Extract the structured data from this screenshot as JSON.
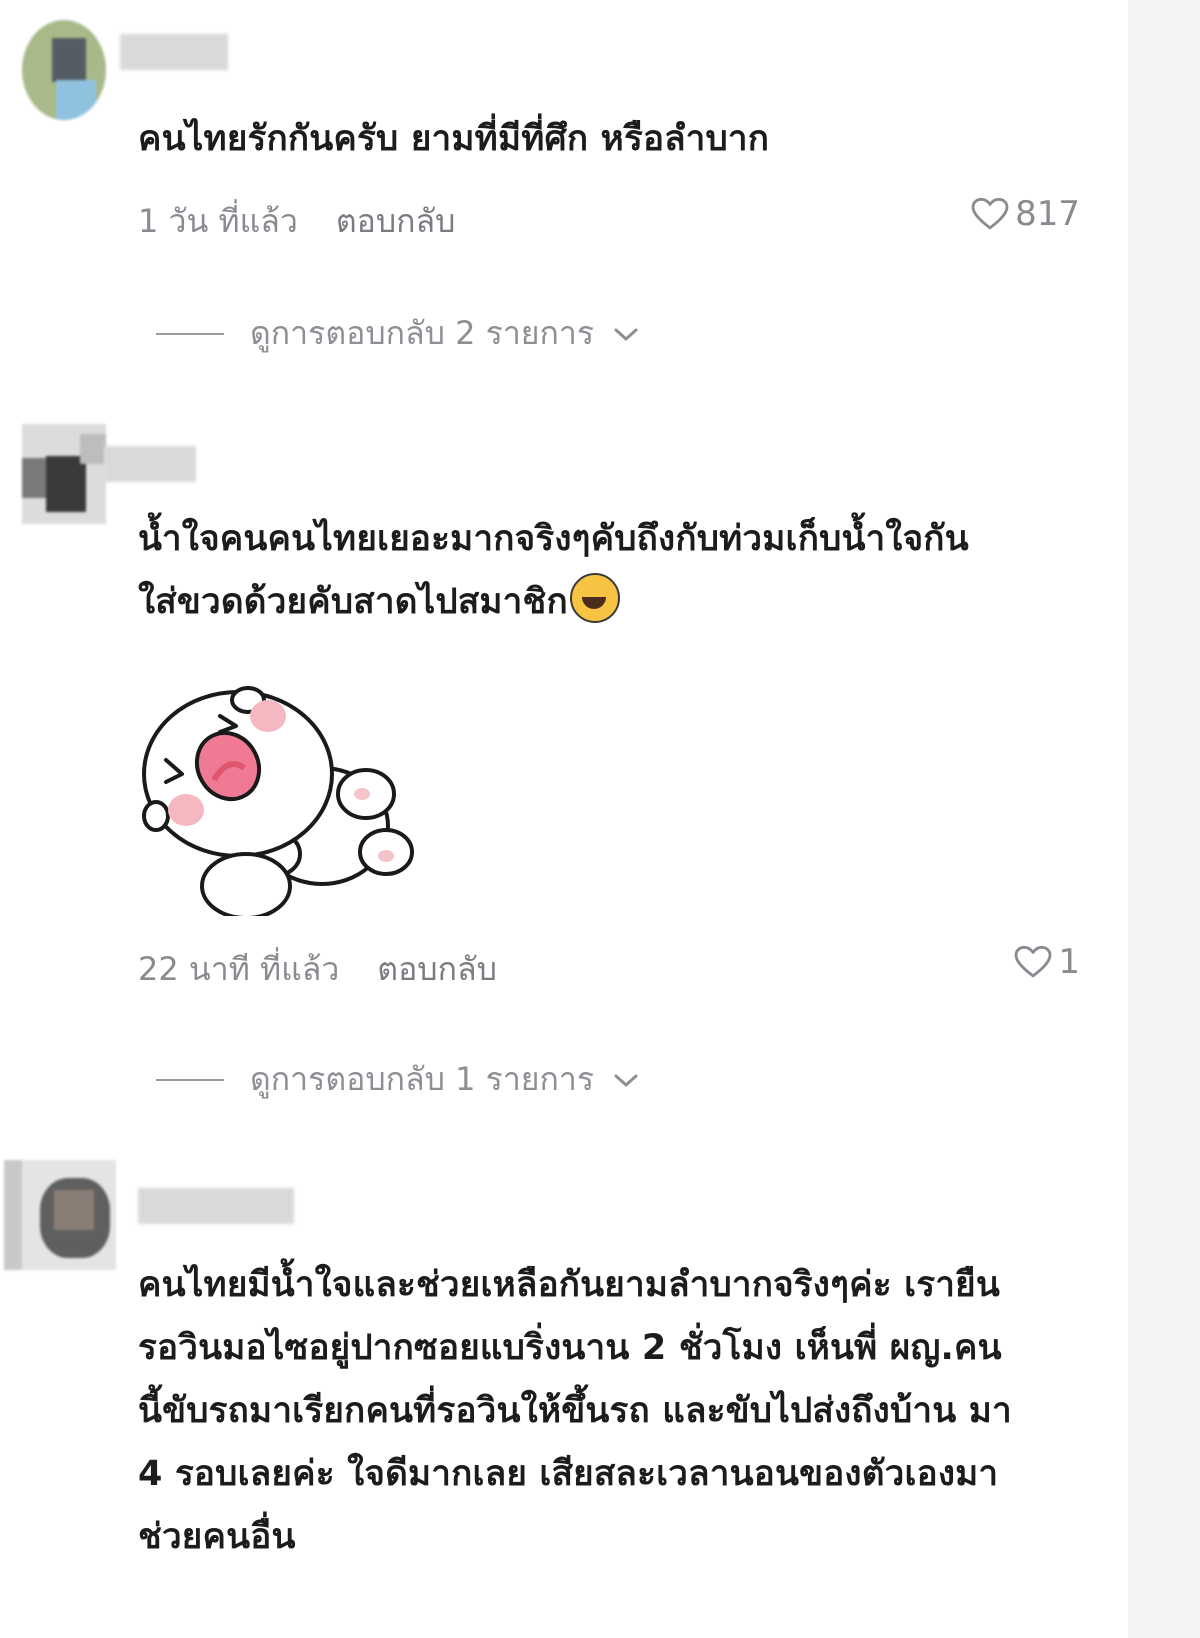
{
  "comments": [
    {
      "text": "คนไทยรักกันครับ ยามที่มีที่ศึก หรือลำบาก",
      "time": "1 วัน ที่แล้ว",
      "reply": "ตอบกลับ",
      "likes": "817",
      "view_replies": "ดูการตอบกลับ 2 รายการ"
    },
    {
      "text_line1": "น้ำใจคนคนไทยเยอะมากจริงๆคับถึงกับท่วมเก็บน้ำใจกัน",
      "text_line2": "ใส่ขวดด้วยคับสาดไปสมาชิก",
      "emoji": "laughing-face-icon",
      "sticker": "laughing-bear-sticker",
      "time": "22 นาที ที่แล้ว",
      "reply": "ตอบกลับ",
      "likes": "1",
      "view_replies": "ดูการตอบกลับ 1 รายการ"
    },
    {
      "lines": [
        "คนไทยมีน้ำใจและช่วยเหลือกันยามลำบากจริงๆค่ะ เรายืน",
        "รอวินมอไซอยู่ปากซอยแบริ่งนาน 2 ชั่วโมง เห็นพี่ ผญ.คน",
        "นี้ขับรถมาเรียกคนที่รอวินให้ขึ้นรถ และขับไปส่งถึงบ้าน มา",
        "4 รอบเลยค่ะ ใจดีมากเลย เสียสละเวลานอนของตัวเองมา",
        "ช่วยคนอื่น"
      ]
    }
  ]
}
